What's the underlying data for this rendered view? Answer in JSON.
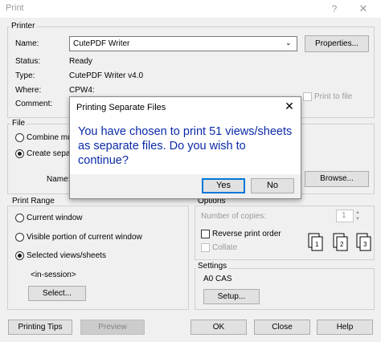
{
  "window": {
    "title": "Print",
    "help_icon": "?",
    "close_icon": "✕"
  },
  "printer": {
    "group_label": "Printer",
    "name_label": "Name:",
    "name_value": "CutePDF Writer",
    "properties_label": "Properties...",
    "status_label": "Status:",
    "status_value": "Ready",
    "type_label": "Type:",
    "type_value": "CutePDF Writer v4.0",
    "where_label": "Where:",
    "where_value": "CPW4:",
    "comment_label": "Comment:",
    "print_to_file_label": "Print to file"
  },
  "file": {
    "group_label": "File",
    "combine_label": "Combine multi",
    "create_separate_label": "Create separa",
    "name_label": "Name:",
    "browse_label": "Browse..."
  },
  "print_range": {
    "group_label": "Print Range",
    "current_window_label": "Current window",
    "visible_portion_label": "Visible portion of current window",
    "selected_views_label": "Selected views/sheets",
    "in_session_label": "<in-session>",
    "select_label": "Select..."
  },
  "options": {
    "group_label": "Options",
    "copies_label": "Number of copies:",
    "copies_value": "1",
    "reverse_label": "Reverse print order",
    "collate_label": "Collate"
  },
  "settings": {
    "group_label": "Settings",
    "value": "A0 CAS",
    "setup_label": "Setup..."
  },
  "footer": {
    "printing_tips_label": "Printing Tips",
    "preview_label": "Preview",
    "ok_label": "OK",
    "close_label": "Close",
    "help_label": "Help"
  },
  "dialog": {
    "title": "Printing Separate Files",
    "close_icon": "✕",
    "message": "You have chosen to print 51 views/sheets as separate files. Do you wish to continue?",
    "yes_label": "Yes",
    "no_label": "No"
  },
  "colors": {
    "accent": "#0078d7",
    "message_text": "#0a2aa8"
  }
}
